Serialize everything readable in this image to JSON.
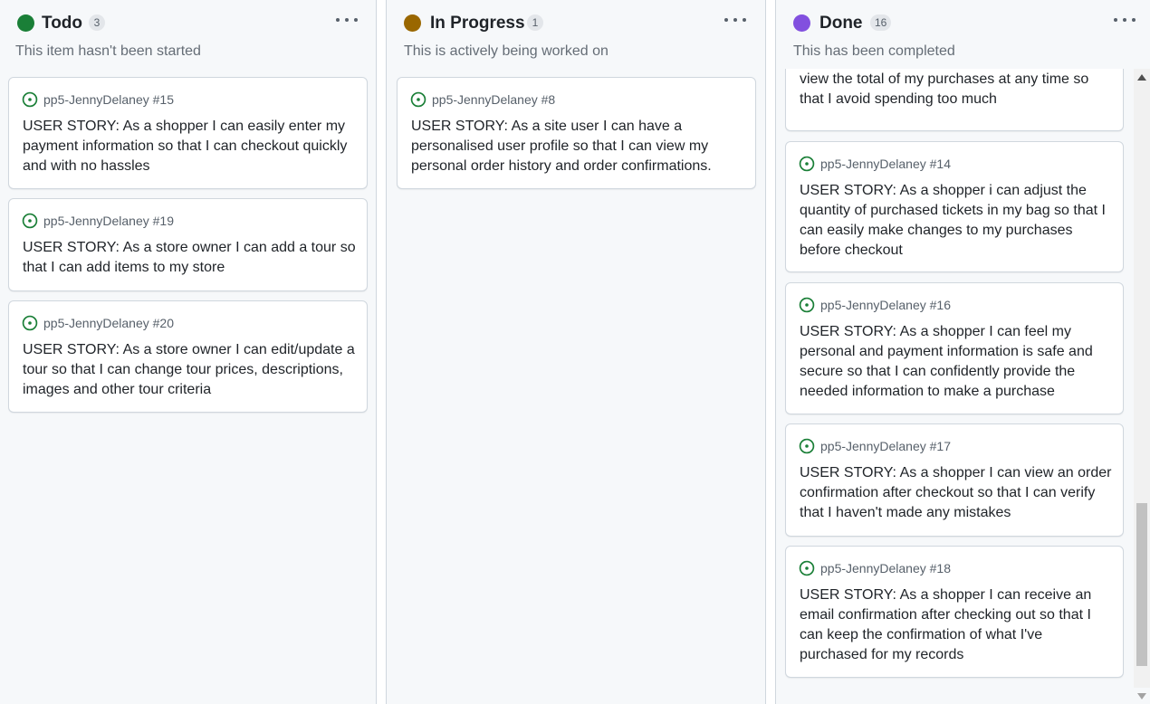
{
  "colors": {
    "todo": "#1a7f37",
    "in_progress": "#9a6700",
    "done": "#8250df",
    "issue_open": "#1a7f37"
  },
  "columns": {
    "todo": {
      "title": "Todo",
      "count": "3",
      "description": "This item hasn't been started",
      "cards": [
        {
          "repo": "pp5-JennyDelaney #15",
          "title": "USER STORY: As a shopper I can easily enter my payment information so that I can checkout quickly and with no hassles"
        },
        {
          "repo": "pp5-JennyDelaney #19",
          "title": "USER STORY: As a store owner I can add a tour so that I can add items to my store"
        },
        {
          "repo": "pp5-JennyDelaney #20",
          "title": "USER STORY: As a store owner I can edit/update a tour so that I can change tour prices, descriptions, images and other tour criteria"
        }
      ]
    },
    "in_progress": {
      "title": "In Progress",
      "count": "1",
      "description": "This is actively being worked on",
      "cards": [
        {
          "repo": "pp5-JennyDelaney #8",
          "title": "USER STORY: As a site user I can have a personalised user profile so that I can view my personal order history and order confirmations."
        }
      ]
    },
    "done": {
      "title": "Done",
      "count": "16",
      "description": "This has been completed",
      "cards": [
        {
          "title": "USER STORY: As a shopper I want to easily view the total of my purchases at any time so that I avoid spending too much"
        },
        {
          "repo": "pp5-JennyDelaney #14",
          "title": "USER STORY: As a shopper i can adjust the quantity of purchased tickets in my bag so that I can easily make changes to my purchases before checkout"
        },
        {
          "repo": "pp5-JennyDelaney #16",
          "title": "USER STORY: As a shopper I can feel my personal and payment information is safe and secure so that I can confidently provide the needed information to make a purchase"
        },
        {
          "repo": "pp5-JennyDelaney #17",
          "title": "USER STORY: As a shopper I can view an order confirmation after checkout so that I can verify that I haven't made any mistakes"
        },
        {
          "repo": "pp5-JennyDelaney #18",
          "title": "USER STORY: As a shopper I can receive an email confirmation after checking out so that I can keep the confirmation of what I've purchased for my records"
        }
      ]
    }
  },
  "icons": {
    "status": "circle-dot-icon",
    "issue": "issue-opened-icon",
    "menu": "kebab-horizontal-icon",
    "scroll_up": "triangle-up-icon",
    "scroll_down": "triangle-down-icon"
  }
}
